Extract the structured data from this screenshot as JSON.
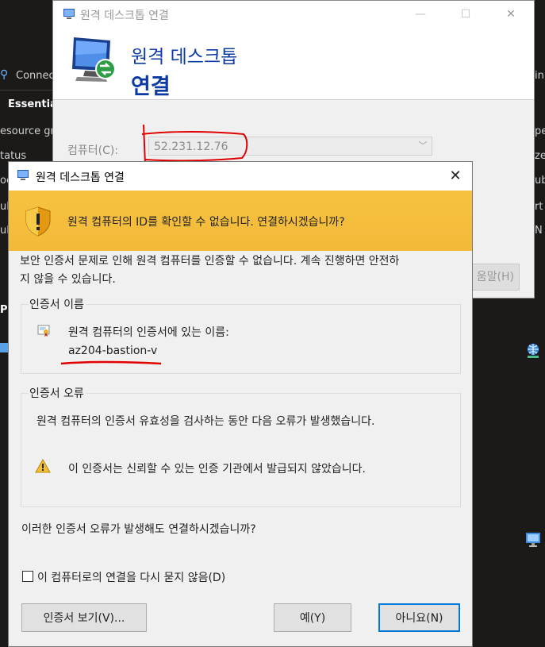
{
  "background_portal": {
    "left_items": [
      "Connec",
      "Essential",
      "esource gr",
      "tatus",
      "ocu",
      "ul",
      "ul",
      "Pr"
    ],
    "right_items": [
      "in",
      "pe",
      "ze",
      "ub",
      "rt",
      "N"
    ]
  },
  "back_window": {
    "title": "원격 데스크톱 연결",
    "banner_line1": "원격 데스크톱",
    "banner_line2": "연결",
    "computer_label": "컴퓨터(C):",
    "computer_value": "52.231.12.76",
    "partial_button_label": "움말(H)"
  },
  "dialog": {
    "title": "원격 데스크톱 연결",
    "close_glyph": "✕",
    "banner_message": "원격 컴퓨터의 ID를 확인할 수 없습니다. 연결하시겠습니까?",
    "body_line1": "보안 인증서 문제로 인해 원격 컴퓨터를 인증할 수 없습니다. 계속 진행하면 안전하",
    "body_line2": "지 않을 수 있습니다.",
    "cert_name_group": {
      "legend": "인증서 이름",
      "description": "원격 컴퓨터의 인증서에 있는 이름:",
      "name": "az204-bastion-v"
    },
    "cert_error_group": {
      "legend": "인증서 오류",
      "description": "원격 컴퓨터의 인증서 유효성을 검사하는 동안 다음 오류가 발생했습니다.",
      "error": "이 인증서는 신뢰할 수 있는 인증 기관에서 발급되지 않았습니다."
    },
    "question": "이러한 인증서 오류가 발생해도 연결하시겠습니까?",
    "checkbox_label": "이 컴퓨터로의 연결을 다시 묻지 않음(D)",
    "checkbox_checked": false,
    "buttons": {
      "view_cert": "인증서 보기(V)...",
      "yes": "예(Y)",
      "no": "아니요(N)"
    }
  },
  "colors": {
    "banner_yellow": "#f3b93a",
    "title_blue": "#0b3aa5",
    "annotation_red": "#e00000",
    "default_button_border": "#0078d7"
  }
}
